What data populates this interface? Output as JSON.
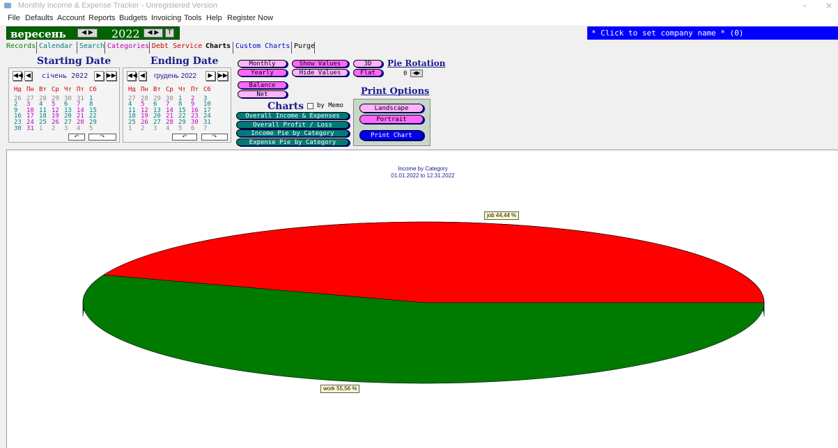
{
  "window": {
    "title": "Monthly Income & Expense Tracker - Unregistered Version",
    "minimize": "–",
    "close": "×"
  },
  "menu": [
    "File",
    "Defaults",
    "Account",
    "Reports",
    "Budgets",
    "Invoicing",
    "Tools",
    "Help",
    "Register Now"
  ],
  "period": {
    "month": "вересень",
    "year": "2022",
    "today_btn": "T"
  },
  "company": {
    "label": "* Click to set company name * (0)"
  },
  "tabs": [
    {
      "label": "Records",
      "color": "#008000"
    },
    {
      "label": "Calendar",
      "color": "#008080"
    },
    {
      "label": "Search",
      "color": "#008080"
    },
    {
      "label": "Categories",
      "color": "#c000c0"
    },
    {
      "label": "Debt Service",
      "color": "#cc0000"
    },
    {
      "label": "Charts",
      "color": "#000000"
    },
    {
      "label": "Custom Charts",
      "color": "#0000cc"
    },
    {
      "label": "Purge",
      "color": "#000000"
    }
  ],
  "start_cal": {
    "title": "Starting Date",
    "month": "січень 2022",
    "weekdays": [
      "Нд",
      "Пн",
      "Вт",
      "Ср",
      "Чт",
      "Пт",
      "Сб"
    ],
    "weeks": [
      [
        "26",
        "27",
        "28",
        "29",
        "30",
        "31",
        "1"
      ],
      [
        "2",
        "3",
        "4",
        "5",
        "6",
        "7",
        "8"
      ],
      [
        "9",
        "10",
        "11",
        "12",
        "13",
        "14",
        "15"
      ],
      [
        "16",
        "17",
        "18",
        "19",
        "20",
        "21",
        "22"
      ],
      [
        "23",
        "24",
        "25",
        "26",
        "27",
        "28",
        "29"
      ],
      [
        "30",
        "31",
        "1",
        "2",
        "3",
        "4",
        "5"
      ]
    ],
    "foot_undo": "↶",
    "foot_redo": "↷"
  },
  "end_cal": {
    "title": "Ending Date",
    "month": "грудень 2022",
    "weekdays": [
      "Нд",
      "Пн",
      "Вт",
      "Ср",
      "Чт",
      "Пт",
      "Сб"
    ],
    "weeks": [
      [
        "27",
        "28",
        "29",
        "30",
        "1",
        "2",
        "3"
      ],
      [
        "4",
        "5",
        "6",
        "7",
        "8",
        "9",
        "10"
      ],
      [
        "11",
        "12",
        "13",
        "14",
        "15",
        "16",
        "17"
      ],
      [
        "18",
        "19",
        "20",
        "21",
        "22",
        "23",
        "24"
      ],
      [
        "25",
        "26",
        "27",
        "28",
        "29",
        "30",
        "31"
      ],
      [
        "1",
        "2",
        "3",
        "4",
        "5",
        "6",
        "7"
      ]
    ],
    "foot_undo": "↶",
    "foot_redo": "↷"
  },
  "options": {
    "monthly": "Monthly",
    "yearly": "Yearly",
    "show_values": "Show Values",
    "hide_values": "Hide Values",
    "three_d": "3D",
    "flat": "Flat",
    "pie_rotation": "Pie Rotation",
    "rotation_value": "0",
    "balance": "Balance",
    "net": "Net"
  },
  "charts_menu": {
    "heading": "Charts",
    "by_memo": "by Memo",
    "items": [
      "Overall Income & Expenses",
      "Overall Profit / Loss",
      "Income Pie by Category",
      "Expense Pie by Category"
    ]
  },
  "print": {
    "heading": "Print Options",
    "landscape": "Landscape",
    "portrait": "Portrait",
    "print_chart": "Print Chart"
  },
  "chart_data": {
    "type": "pie",
    "title": "Income by Category",
    "subtitle": "01.01.2022 to 12.31.2022",
    "style": "3D",
    "slices": [
      {
        "name": "job",
        "value": 44.44,
        "label": "job 44,44 %",
        "color": "#ff0000"
      },
      {
        "name": "work",
        "value": 55.56,
        "label": "work 55,56 %",
        "color": "#007a00"
      }
    ]
  }
}
